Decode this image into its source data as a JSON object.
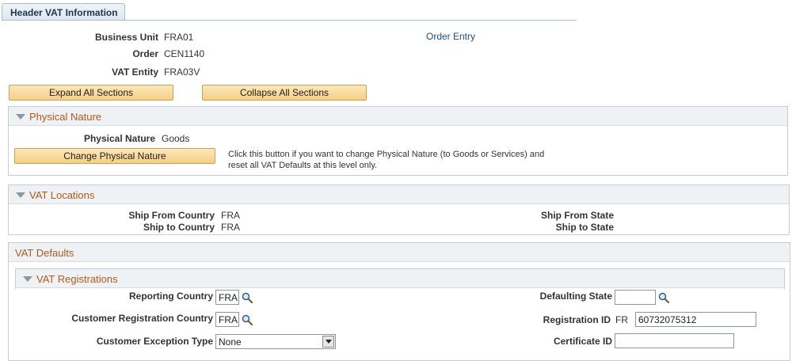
{
  "tab": {
    "label": "Header VAT Information"
  },
  "header": {
    "business_unit_label": "Business Unit",
    "business_unit_value": "FRA01",
    "order_label": "Order",
    "order_value": "CEN1140",
    "vat_entity_label": "VAT Entity",
    "vat_entity_value": "FRA03V",
    "order_entry_link": "Order Entry"
  },
  "buttons": {
    "expand_all": "Expand All Sections",
    "collapse_all": "Collapse All Sections"
  },
  "physical_nature": {
    "title": "Physical Nature",
    "field_label": "Physical Nature",
    "field_value": "Goods",
    "change_button": "Change Physical Nature",
    "note_line1": "Click this button if you want to change Physical Nature (to Goods or Services) and",
    "note_line2": "reset all VAT Defaults at this level only."
  },
  "vat_locations": {
    "title": "VAT Locations",
    "ship_from_country_label": "Ship From Country",
    "ship_from_country_value": "FRA",
    "ship_to_country_label": "Ship to Country",
    "ship_to_country_value": "FRA",
    "ship_from_state_label": "Ship From State",
    "ship_to_state_label": "Ship to State"
  },
  "vat_defaults": {
    "title": "VAT Defaults",
    "registrations": {
      "title": "VAT Registrations",
      "reporting_country_label": "Reporting Country",
      "reporting_country_value": "FRA",
      "customer_reg_country_label": "Customer Registration Country",
      "customer_reg_country_value": "FRA",
      "customer_exception_label": "Customer Exception Type",
      "customer_exception_value": "None",
      "defaulting_state_label": "Defaulting State",
      "defaulting_state_value": "",
      "registration_id_label": "Registration ID",
      "registration_id_prefix": "FR",
      "registration_id_value": "60732075312",
      "certificate_id_label": "Certificate ID",
      "certificate_id_value": ""
    }
  },
  "colors": {
    "section_title": "#b4581a",
    "link": "#1f4e8a",
    "button_bg": "#f6cf86"
  }
}
